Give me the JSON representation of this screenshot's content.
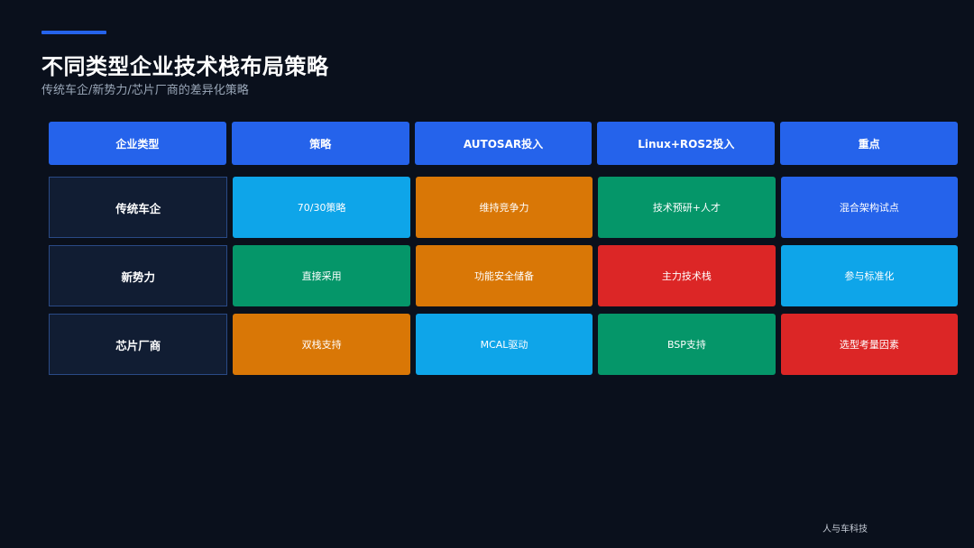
{
  "slide": {
    "title": "不同类型企业技术栈布局策略",
    "subtitle": "传统车企/新势力/芯片厂商的差异化策略",
    "footer": "人与车科技"
  },
  "colors": {
    "background": "#0a101c",
    "accent": "#2563eb",
    "header": "#2563eb",
    "row_label_bg": "#111d33",
    "row_label_border": "#2a4a86",
    "sky": "#0ea5e9",
    "orange": "#d97706",
    "green": "#059669",
    "red": "#dc2626",
    "blue": "#2563eb"
  },
  "table": {
    "headers": [
      "企业类型",
      "策略",
      "AUTOSAR投入",
      "Linux+ROS2投入",
      "重点"
    ],
    "rows": [
      {
        "label": "传统车企",
        "cells": [
          {
            "text": "70/30策略",
            "color": "#0ea5e9"
          },
          {
            "text": "维持竞争力",
            "color": "#d97706"
          },
          {
            "text": "技术预研+人才",
            "color": "#059669"
          },
          {
            "text": "混合架构试点",
            "color": "#2563eb"
          }
        ]
      },
      {
        "label": "新势力",
        "cells": [
          {
            "text": "直接采用",
            "color": "#059669"
          },
          {
            "text": "功能安全储备",
            "color": "#d97706"
          },
          {
            "text": "主力技术栈",
            "color": "#dc2626"
          },
          {
            "text": "参与标准化",
            "color": "#0ea5e9"
          }
        ]
      },
      {
        "label": "芯片厂商",
        "cells": [
          {
            "text": "双栈支持",
            "color": "#d97706"
          },
          {
            "text": "MCAL驱动",
            "color": "#0ea5e9"
          },
          {
            "text": "BSP支持",
            "color": "#059669"
          },
          {
            "text": "选型考量因素",
            "color": "#dc2626"
          }
        ]
      }
    ]
  }
}
